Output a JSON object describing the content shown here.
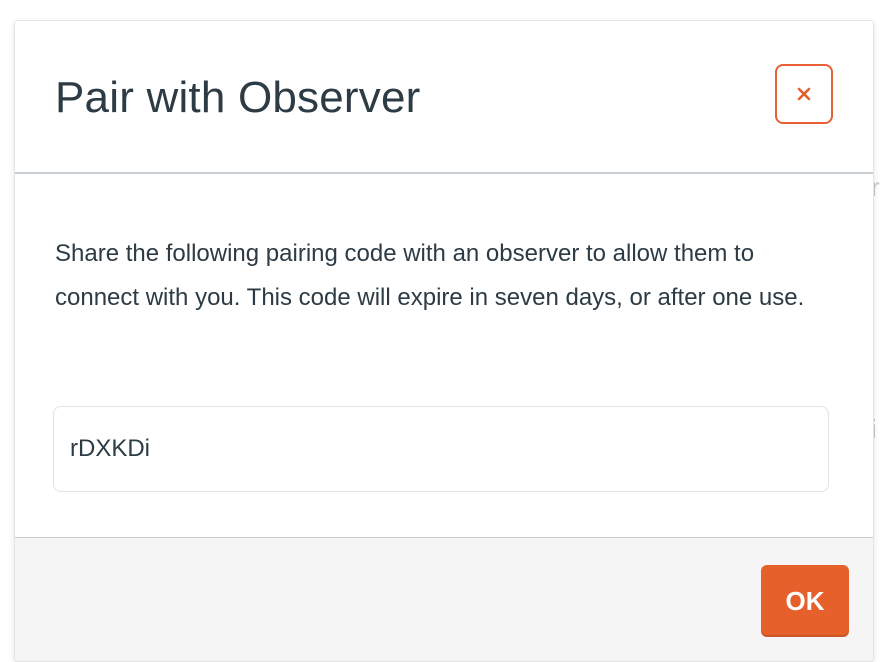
{
  "dialog": {
    "title": "Pair with Observer",
    "close_icon": "close-icon",
    "body_text": "Share the following pairing code with an observer to allow them to connect with you. This code will expire in seven days, or after one use.",
    "pairing_code": "rDXKDi",
    "ok_label": "OK"
  },
  "colors": {
    "accent": "#e6602c",
    "text": "#2d3b45",
    "footer_bg": "#f5f5f5",
    "divider": "#c7cdd1"
  }
}
